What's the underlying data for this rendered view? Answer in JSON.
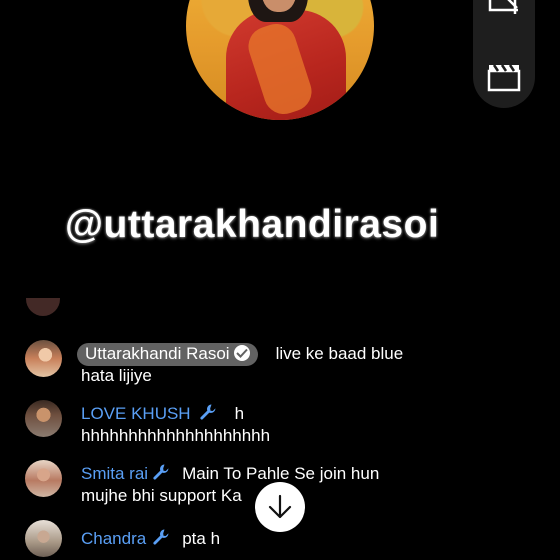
{
  "channel": {
    "handle": "@uttarakhandirasoi"
  },
  "toolbar": {
    "icons": [
      "crop-icon",
      "clapperboard-icon"
    ]
  },
  "chat": {
    "messages": [
      {
        "author": "Uttarakhandi Rasoi",
        "owner": true,
        "verified": true,
        "line1": "live ke baad blue",
        "line2": "hata lijiye"
      },
      {
        "author": "LOVE KHUSH",
        "moderator": true,
        "line1": "h",
        "line2": "hhhhhhhhhhhhhhhhhhhh"
      },
      {
        "author": "Smita rai",
        "moderator": true,
        "line1": "Main To Pahle Se join hun",
        "line2": "mujhe bhi support Ka"
      },
      {
        "author": "Chandra",
        "moderator": true,
        "line1": "pta h",
        "line2": ""
      }
    ]
  },
  "colors": {
    "moderator_name": "#5a9ff5",
    "owner_chip": "#626262",
    "background": "#000000"
  }
}
